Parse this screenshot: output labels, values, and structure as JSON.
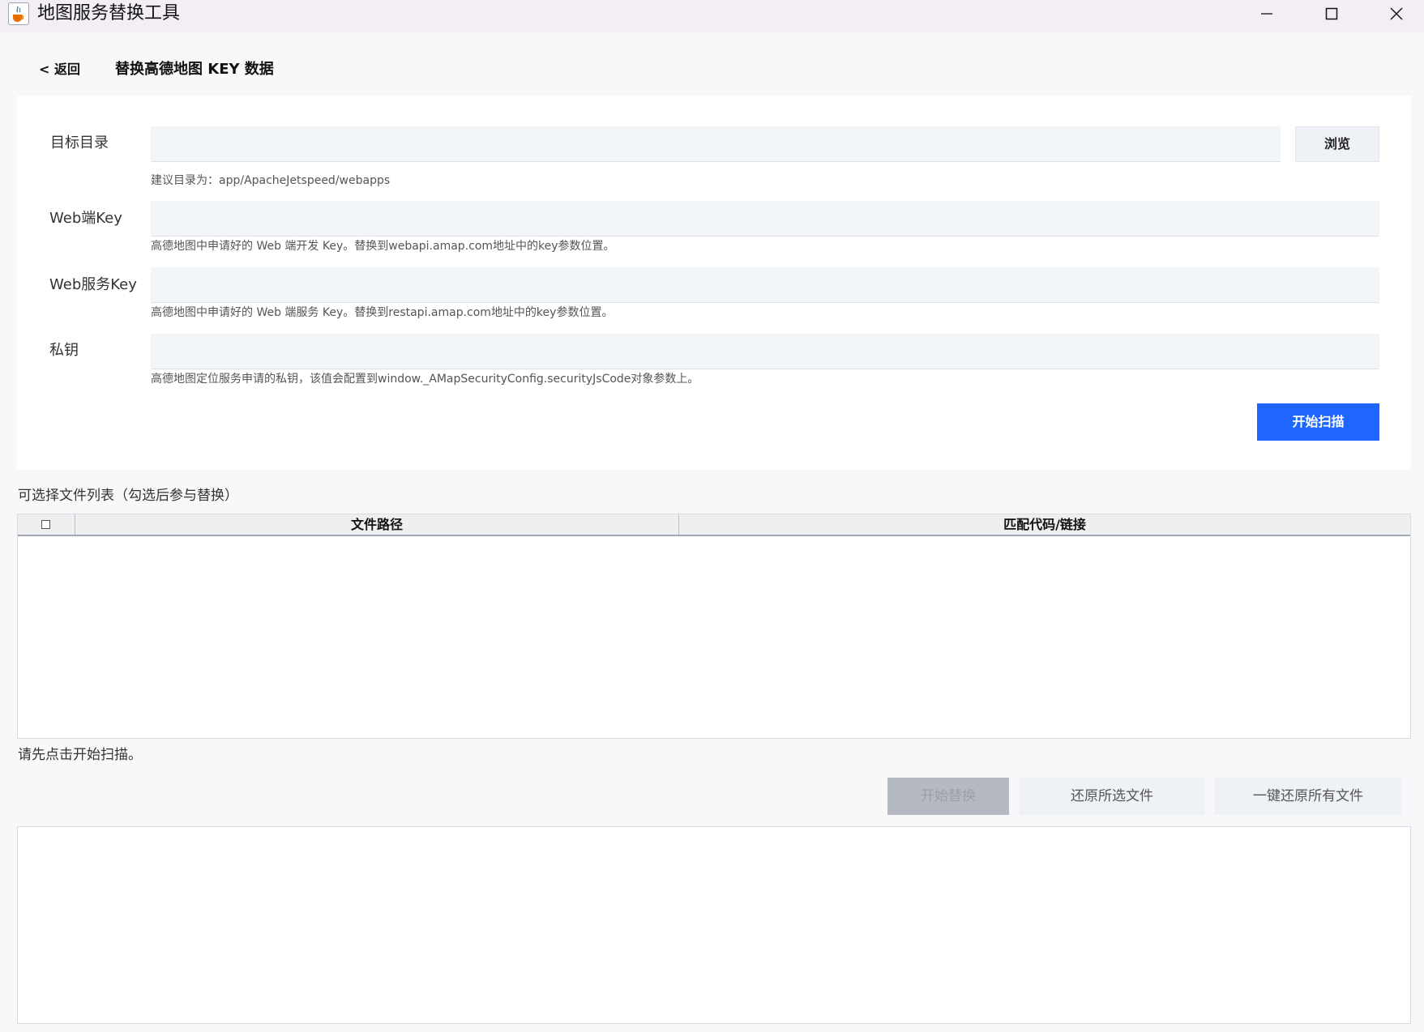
{
  "window": {
    "title": "地图服务替换工具",
    "icon": "java-cup-icon"
  },
  "header": {
    "back_label": "< 返回",
    "page_title": "替换高德地图 KEY 数据"
  },
  "form": {
    "target_dir": {
      "label": "目标目录",
      "value": "",
      "browse_label": "浏览",
      "hint": "建议目录为：app/ApacheJetspeed/webapps"
    },
    "web_key": {
      "label": "Web端Key",
      "value": "",
      "hint": "高德地图中申请好的 Web 端开发 Key。替换到webapi.amap.com地址中的key参数位置。"
    },
    "web_service_key": {
      "label": "Web服务Key",
      "value": "",
      "hint": "高德地图中申请好的 Web 端服务 Key。替换到restapi.amap.com地址中的key参数位置。"
    },
    "private_key": {
      "label": "私钥",
      "value": "",
      "hint": "高德地图定位服务申请的私钥，该值会配置到window._AMapSecurityConfig.securityJsCode对象参数上。"
    },
    "scan_label": "开始扫描"
  },
  "file_list": {
    "caption": "可选择文件列表（勾选后参与替换）",
    "columns": [
      "文件路径",
      "匹配代码/链接"
    ],
    "select_all_checked": false,
    "rows": []
  },
  "status": "请先点击开始扫描。",
  "actions": {
    "replace_label": "开始替换",
    "restore_selected_label": "还原所选文件",
    "restore_all_label": "一键还原所有文件"
  },
  "colors": {
    "primary": "#1f66ff",
    "disabled": "#b5bac2",
    "input_bg": "#f3f6f9"
  }
}
